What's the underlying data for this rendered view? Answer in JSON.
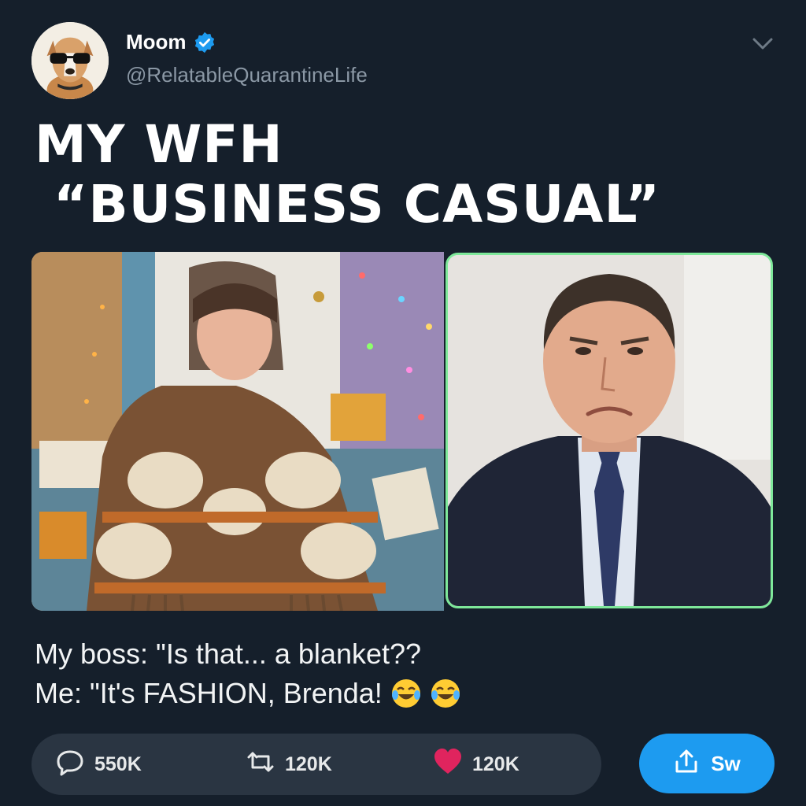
{
  "tweet": {
    "author": {
      "display_name": "Moom",
      "handle": "@RelatableQuarantineLife",
      "verified": true
    },
    "headline": "MY WFH\n “BUSINESS CASUAL”",
    "caption_line1": "My boss: \"Is that... a blanket??",
    "caption_line2": "Me: \"It's FASHION, Brenda!",
    "caption_emojis": [
      "laughing-crying-emoji",
      "laughing-crying-emoji"
    ],
    "images": [
      {
        "name": "person-in-cat-blanket-photo"
      },
      {
        "name": "frowning-boss-video-call-photo",
        "border_color": "#7ee89a"
      }
    ]
  },
  "actions": {
    "replies": "550K",
    "retweets": "120K",
    "likes": "120K",
    "share_label": "Sw"
  },
  "colors": {
    "background": "#151f2b",
    "accent": "#1d9bf0",
    "action_bar": "#2a3542",
    "handle_text": "#8b98a5",
    "like": "#e0245e"
  },
  "icons": [
    "chevron-down-icon",
    "verified-badge-icon",
    "reply-icon",
    "retweet-icon",
    "heart-icon",
    "share-icon"
  ]
}
